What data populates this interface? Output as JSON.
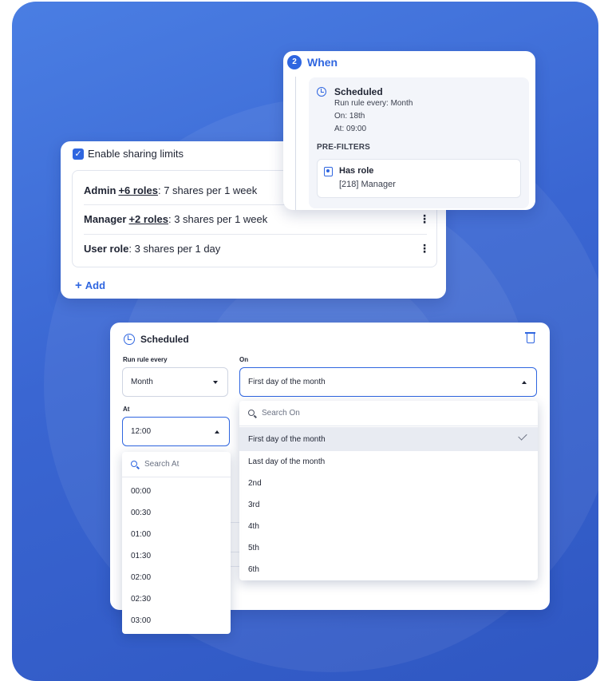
{
  "sharing": {
    "enable_label": "Enable sharing limits",
    "rows": [
      {
        "name": "Admin",
        "extra": "+6 roles",
        "rest": ": 7 shares per 1 week"
      },
      {
        "name": "Manager",
        "extra": "+2 roles",
        "rest": ": 3 shares per 1 week"
      },
      {
        "name": "User role",
        "extra": "",
        "rest": ": 3 shares per 1 day"
      }
    ],
    "add_label": "Add"
  },
  "when": {
    "step": "2",
    "title": "When",
    "schedule_title": "Scheduled",
    "run_line": "Run rule every: Month",
    "on_line": "On: 18th",
    "at_line": "At: 09:00",
    "prefilters_label": "PRE-FILTERS",
    "has_role_label": "Has role",
    "has_role_value": "[218] Manager"
  },
  "scheduled": {
    "title": "Scheduled",
    "run_every_label": "Run rule every",
    "run_every_value": "Month",
    "on_label": "On",
    "on_value": "First day of the month",
    "at_label": "At",
    "at_value": "12:00"
  },
  "on_dropdown": {
    "search_placeholder": "Search On",
    "options": [
      "First day of the month",
      "Last day of the month",
      "2nd",
      "3rd",
      "4th",
      "5th",
      "6th"
    ],
    "selected": "First day of the month"
  },
  "at_dropdown": {
    "search_placeholder": "Search At",
    "options": [
      "00:00",
      "00:30",
      "01:00",
      "01:30",
      "02:00",
      "02:30",
      "03:00"
    ]
  },
  "colors": {
    "accent": "#2f66e0",
    "background": "#3a66d2"
  }
}
